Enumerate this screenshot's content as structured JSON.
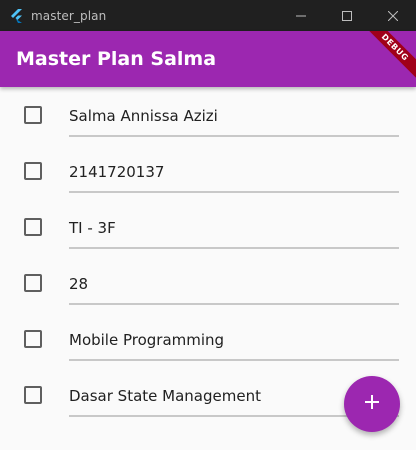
{
  "window": {
    "title": "master_plan",
    "icon": "flutter-icon",
    "controls": [
      "minimize-icon",
      "maximize-icon",
      "close-icon"
    ]
  },
  "appbar": {
    "title": "Master Plan Salma",
    "debug_banner": "DEBUG"
  },
  "tasks": [
    {
      "text": "Salma Annissa Azizi",
      "done": false
    },
    {
      "text": "2141720137",
      "done": false
    },
    {
      "text": "TI - 3F",
      "done": false
    },
    {
      "text": "28",
      "done": false
    },
    {
      "text": "Mobile Programming",
      "done": false
    },
    {
      "text": "Dasar State Management",
      "done": false
    }
  ],
  "fab": {
    "icon": "add-icon",
    "label": "+"
  },
  "colors": {
    "primary": "#9c27b0",
    "titlebar": "#202020",
    "background": "#fafafa",
    "debug": "#a0001a"
  }
}
